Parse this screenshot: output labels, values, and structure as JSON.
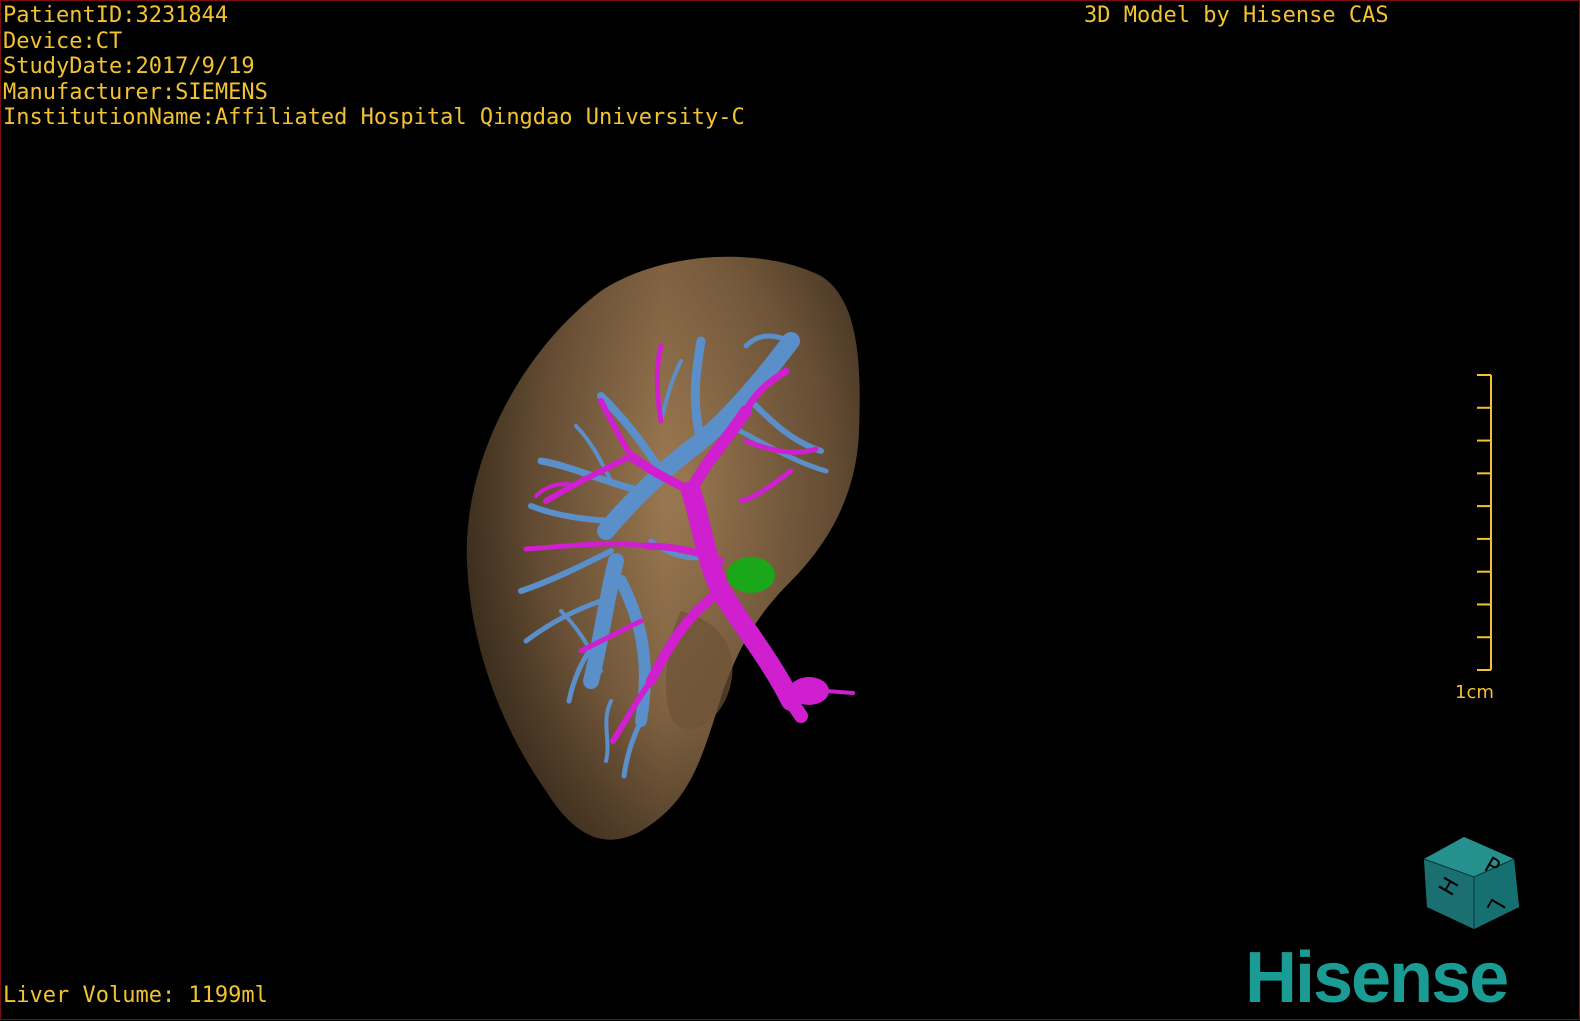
{
  "overlay": {
    "patient_id": "PatientID:3231844",
    "device": "Device:CT",
    "study_date": "StudyDate:2017/9/19",
    "manufacturer": "Manufacturer:SIEMENS",
    "institution": "InstitutionName:Affiliated Hospital Qingdao University-C",
    "credit": "3D Model by Hisense CAS",
    "liver_volume": "Liver Volume: 1199ml"
  },
  "scale_bar": {
    "label": "1cm",
    "tick_count": 10
  },
  "orientation_cube": {
    "faces": [
      "P",
      "H",
      "L"
    ],
    "color": "#1f7f80"
  },
  "brand_logo": "Hisense",
  "colors": {
    "text": "#f2c230",
    "liver": "#8a6a45",
    "hepatic_vein": "#5b8fca",
    "portal_vein": "#cf1fcf",
    "lesion": "#1aa81a",
    "brand": "#1a9b94",
    "border": "#7a0c14"
  }
}
